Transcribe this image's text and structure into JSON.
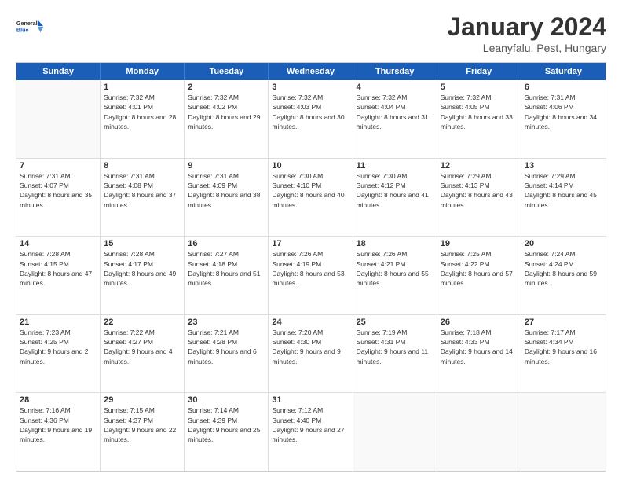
{
  "header": {
    "logo_line1": "General",
    "logo_line2": "Blue",
    "title": "January 2024",
    "location": "Leanyfalu, Pest, Hungary"
  },
  "weekdays": [
    "Sunday",
    "Monday",
    "Tuesday",
    "Wednesday",
    "Thursday",
    "Friday",
    "Saturday"
  ],
  "rows": [
    [
      {
        "day": "",
        "sunrise": "",
        "sunset": "",
        "daylight": ""
      },
      {
        "day": "1",
        "sunrise": "Sunrise: 7:32 AM",
        "sunset": "Sunset: 4:01 PM",
        "daylight": "Daylight: 8 hours and 28 minutes."
      },
      {
        "day": "2",
        "sunrise": "Sunrise: 7:32 AM",
        "sunset": "Sunset: 4:02 PM",
        "daylight": "Daylight: 8 hours and 29 minutes."
      },
      {
        "day": "3",
        "sunrise": "Sunrise: 7:32 AM",
        "sunset": "Sunset: 4:03 PM",
        "daylight": "Daylight: 8 hours and 30 minutes."
      },
      {
        "day": "4",
        "sunrise": "Sunrise: 7:32 AM",
        "sunset": "Sunset: 4:04 PM",
        "daylight": "Daylight: 8 hours and 31 minutes."
      },
      {
        "day": "5",
        "sunrise": "Sunrise: 7:32 AM",
        "sunset": "Sunset: 4:05 PM",
        "daylight": "Daylight: 8 hours and 33 minutes."
      },
      {
        "day": "6",
        "sunrise": "Sunrise: 7:31 AM",
        "sunset": "Sunset: 4:06 PM",
        "daylight": "Daylight: 8 hours and 34 minutes."
      }
    ],
    [
      {
        "day": "7",
        "sunrise": "Sunrise: 7:31 AM",
        "sunset": "Sunset: 4:07 PM",
        "daylight": "Daylight: 8 hours and 35 minutes."
      },
      {
        "day": "8",
        "sunrise": "Sunrise: 7:31 AM",
        "sunset": "Sunset: 4:08 PM",
        "daylight": "Daylight: 8 hours and 37 minutes."
      },
      {
        "day": "9",
        "sunrise": "Sunrise: 7:31 AM",
        "sunset": "Sunset: 4:09 PM",
        "daylight": "Daylight: 8 hours and 38 minutes."
      },
      {
        "day": "10",
        "sunrise": "Sunrise: 7:30 AM",
        "sunset": "Sunset: 4:10 PM",
        "daylight": "Daylight: 8 hours and 40 minutes."
      },
      {
        "day": "11",
        "sunrise": "Sunrise: 7:30 AM",
        "sunset": "Sunset: 4:12 PM",
        "daylight": "Daylight: 8 hours and 41 minutes."
      },
      {
        "day": "12",
        "sunrise": "Sunrise: 7:29 AM",
        "sunset": "Sunset: 4:13 PM",
        "daylight": "Daylight: 8 hours and 43 minutes."
      },
      {
        "day": "13",
        "sunrise": "Sunrise: 7:29 AM",
        "sunset": "Sunset: 4:14 PM",
        "daylight": "Daylight: 8 hours and 45 minutes."
      }
    ],
    [
      {
        "day": "14",
        "sunrise": "Sunrise: 7:28 AM",
        "sunset": "Sunset: 4:15 PM",
        "daylight": "Daylight: 8 hours and 47 minutes."
      },
      {
        "day": "15",
        "sunrise": "Sunrise: 7:28 AM",
        "sunset": "Sunset: 4:17 PM",
        "daylight": "Daylight: 8 hours and 49 minutes."
      },
      {
        "day": "16",
        "sunrise": "Sunrise: 7:27 AM",
        "sunset": "Sunset: 4:18 PM",
        "daylight": "Daylight: 8 hours and 51 minutes."
      },
      {
        "day": "17",
        "sunrise": "Sunrise: 7:26 AM",
        "sunset": "Sunset: 4:19 PM",
        "daylight": "Daylight: 8 hours and 53 minutes."
      },
      {
        "day": "18",
        "sunrise": "Sunrise: 7:26 AM",
        "sunset": "Sunset: 4:21 PM",
        "daylight": "Daylight: 8 hours and 55 minutes."
      },
      {
        "day": "19",
        "sunrise": "Sunrise: 7:25 AM",
        "sunset": "Sunset: 4:22 PM",
        "daylight": "Daylight: 8 hours and 57 minutes."
      },
      {
        "day": "20",
        "sunrise": "Sunrise: 7:24 AM",
        "sunset": "Sunset: 4:24 PM",
        "daylight": "Daylight: 8 hours and 59 minutes."
      }
    ],
    [
      {
        "day": "21",
        "sunrise": "Sunrise: 7:23 AM",
        "sunset": "Sunset: 4:25 PM",
        "daylight": "Daylight: 9 hours and 2 minutes."
      },
      {
        "day": "22",
        "sunrise": "Sunrise: 7:22 AM",
        "sunset": "Sunset: 4:27 PM",
        "daylight": "Daylight: 9 hours and 4 minutes."
      },
      {
        "day": "23",
        "sunrise": "Sunrise: 7:21 AM",
        "sunset": "Sunset: 4:28 PM",
        "daylight": "Daylight: 9 hours and 6 minutes."
      },
      {
        "day": "24",
        "sunrise": "Sunrise: 7:20 AM",
        "sunset": "Sunset: 4:30 PM",
        "daylight": "Daylight: 9 hours and 9 minutes."
      },
      {
        "day": "25",
        "sunrise": "Sunrise: 7:19 AM",
        "sunset": "Sunset: 4:31 PM",
        "daylight": "Daylight: 9 hours and 11 minutes."
      },
      {
        "day": "26",
        "sunrise": "Sunrise: 7:18 AM",
        "sunset": "Sunset: 4:33 PM",
        "daylight": "Daylight: 9 hours and 14 minutes."
      },
      {
        "day": "27",
        "sunrise": "Sunrise: 7:17 AM",
        "sunset": "Sunset: 4:34 PM",
        "daylight": "Daylight: 9 hours and 16 minutes."
      }
    ],
    [
      {
        "day": "28",
        "sunrise": "Sunrise: 7:16 AM",
        "sunset": "Sunset: 4:36 PM",
        "daylight": "Daylight: 9 hours and 19 minutes."
      },
      {
        "day": "29",
        "sunrise": "Sunrise: 7:15 AM",
        "sunset": "Sunset: 4:37 PM",
        "daylight": "Daylight: 9 hours and 22 minutes."
      },
      {
        "day": "30",
        "sunrise": "Sunrise: 7:14 AM",
        "sunset": "Sunset: 4:39 PM",
        "daylight": "Daylight: 9 hours and 25 minutes."
      },
      {
        "day": "31",
        "sunrise": "Sunrise: 7:12 AM",
        "sunset": "Sunset: 4:40 PM",
        "daylight": "Daylight: 9 hours and 27 minutes."
      },
      {
        "day": "",
        "sunrise": "",
        "sunset": "",
        "daylight": ""
      },
      {
        "day": "",
        "sunrise": "",
        "sunset": "",
        "daylight": ""
      },
      {
        "day": "",
        "sunrise": "",
        "sunset": "",
        "daylight": ""
      }
    ]
  ]
}
